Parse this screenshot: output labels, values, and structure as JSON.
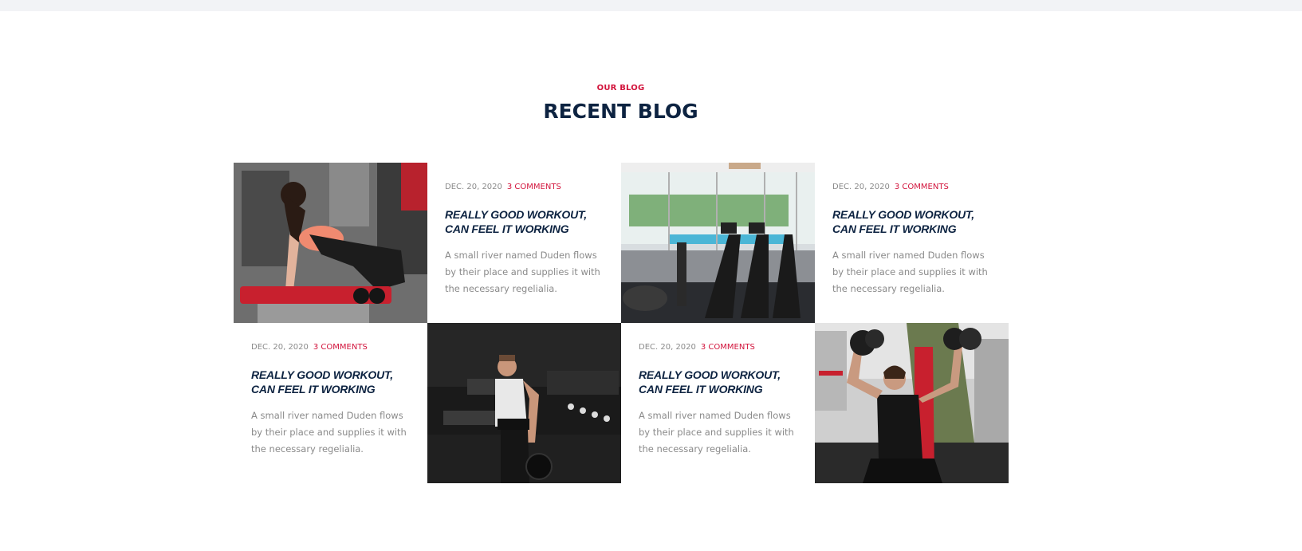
{
  "section": {
    "eyebrow": "OUR BLOG",
    "title": "RECENT BLOG"
  },
  "posts": [
    {
      "date": "DEC. 20, 2020",
      "comments": "3 COMMENTS",
      "title": "REALLY GOOD WORKOUT, CAN FEEL IT WORKING",
      "excerpt": "A small river named Duden flows by their place and supplies it with the necessary regelialia."
    },
    {
      "date": "DEC. 20, 2020",
      "comments": "3 COMMENTS",
      "title": "REALLY GOOD WORKOUT, CAN FEEL IT WORKING",
      "excerpt": "A small river named Duden flows by their place and supplies it with the necessary regelialia."
    },
    {
      "date": "DEC. 20, 2020",
      "comments": "3 COMMENTS",
      "title": "REALLY GOOD WORKOUT, CAN FEEL IT WORKING",
      "excerpt": "A small river named Duden flows by their place and supplies it with the necessary regelialia."
    },
    {
      "date": "DEC. 20, 2020",
      "comments": "3 COMMENTS",
      "title": "REALLY GOOD WORKOUT, CAN FEEL IT WORKING",
      "excerpt": "A small river named Duden flows by their place and supplies it with the necessary regelialia."
    }
  ],
  "colors": {
    "accent": "#d2143c",
    "heading": "#0d2341",
    "muted": "#8a8a8a"
  }
}
